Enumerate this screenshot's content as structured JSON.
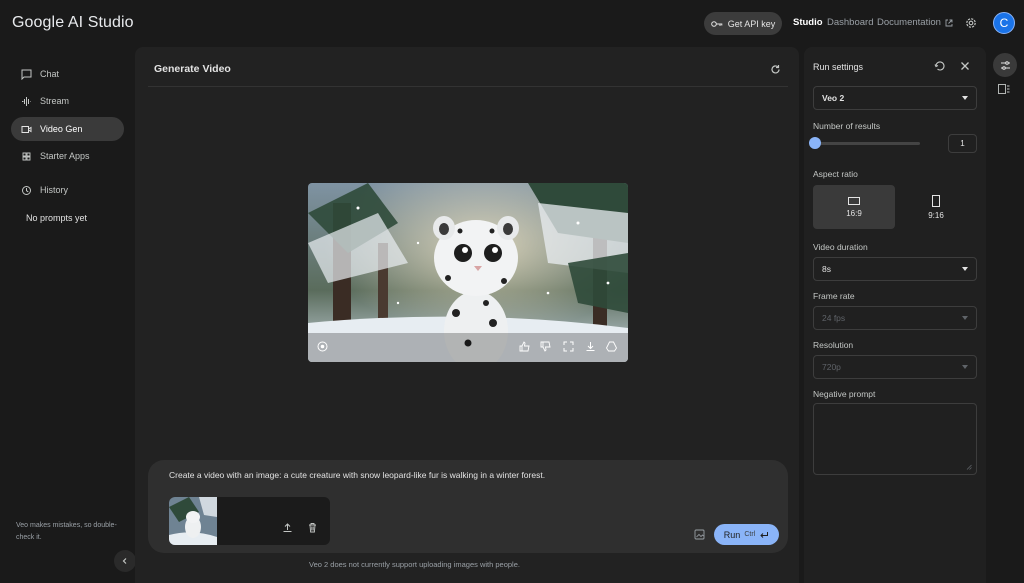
{
  "header": {
    "app_title": "Google AI Studio",
    "api_key_label": "Get API key",
    "nav": [
      "Studio",
      "Dashboard",
      "Documentation"
    ],
    "avatar_letter": "C"
  },
  "sidebar": {
    "items": [
      {
        "label": "Chat",
        "icon": "chat-icon"
      },
      {
        "label": "Stream",
        "icon": "stream-icon"
      },
      {
        "label": "Video Gen",
        "icon": "video-icon",
        "active": true
      },
      {
        "label": "Starter Apps",
        "icon": "apps-icon"
      },
      {
        "label": "History",
        "icon": "history-icon"
      }
    ],
    "empty_text": "No prompts yet",
    "disclaimer": "Veo makes mistakes, so double-check it."
  },
  "main": {
    "title": "Generate Video",
    "prompt_text": "Create a video with an image: a cute creature with snow leopard-like fur is walking in a winter forest.",
    "run_label": "Run",
    "run_shortcut": "Ctrl",
    "notice": "Veo 2 does not currently support uploading images with people."
  },
  "settings": {
    "title": "Run settings",
    "model": "Veo 2",
    "results_label": "Number of results",
    "results_value": "1",
    "aspect_label": "Aspect ratio",
    "aspects": [
      "16:9",
      "9:16"
    ],
    "duration_label": "Video duration",
    "duration_value": "8s",
    "framerate_label": "Frame rate",
    "framerate_value": "24 fps",
    "resolution_label": "Resolution",
    "resolution_value": "720p",
    "negative_label": "Negative prompt"
  },
  "colors": {
    "background": "#1a1a1a",
    "panel": "#222222",
    "accent": "#8ab4f8",
    "avatar": "#1a73e8"
  }
}
